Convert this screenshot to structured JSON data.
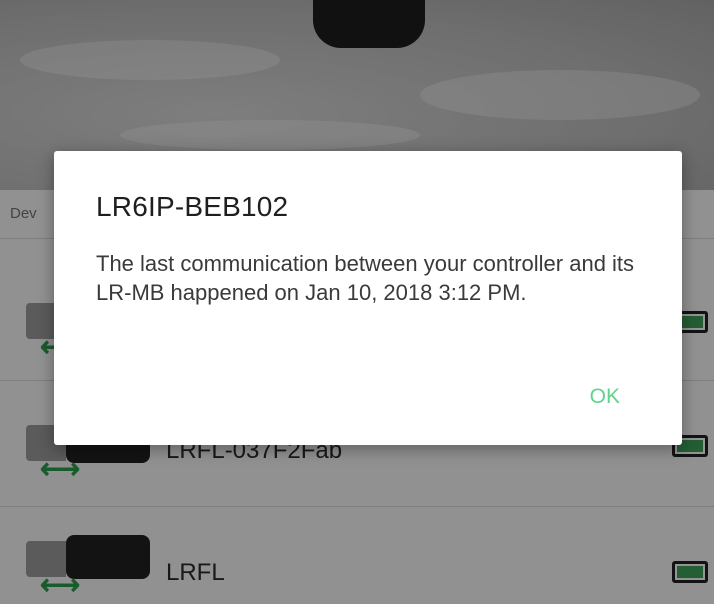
{
  "list": {
    "section_label": "Dev",
    "items": [
      {
        "name": "",
        "battery_icon": "battery-full-icon"
      },
      {
        "name": "LRFL-037F2Fab",
        "battery_icon": "battery-full-icon"
      },
      {
        "name": "LRFL",
        "battery_icon": "battery-full-icon"
      }
    ]
  },
  "dialog": {
    "title": "LR6IP-BEB102",
    "message": "The last communication between your controller and its LR-MB happened on Jan 10, 2018 3:12 PM.",
    "ok_label": "OK"
  },
  "colors": {
    "accent": "#5fd48a",
    "battery_fill": "#3fa35b",
    "arrow": "#2e9e4f"
  }
}
